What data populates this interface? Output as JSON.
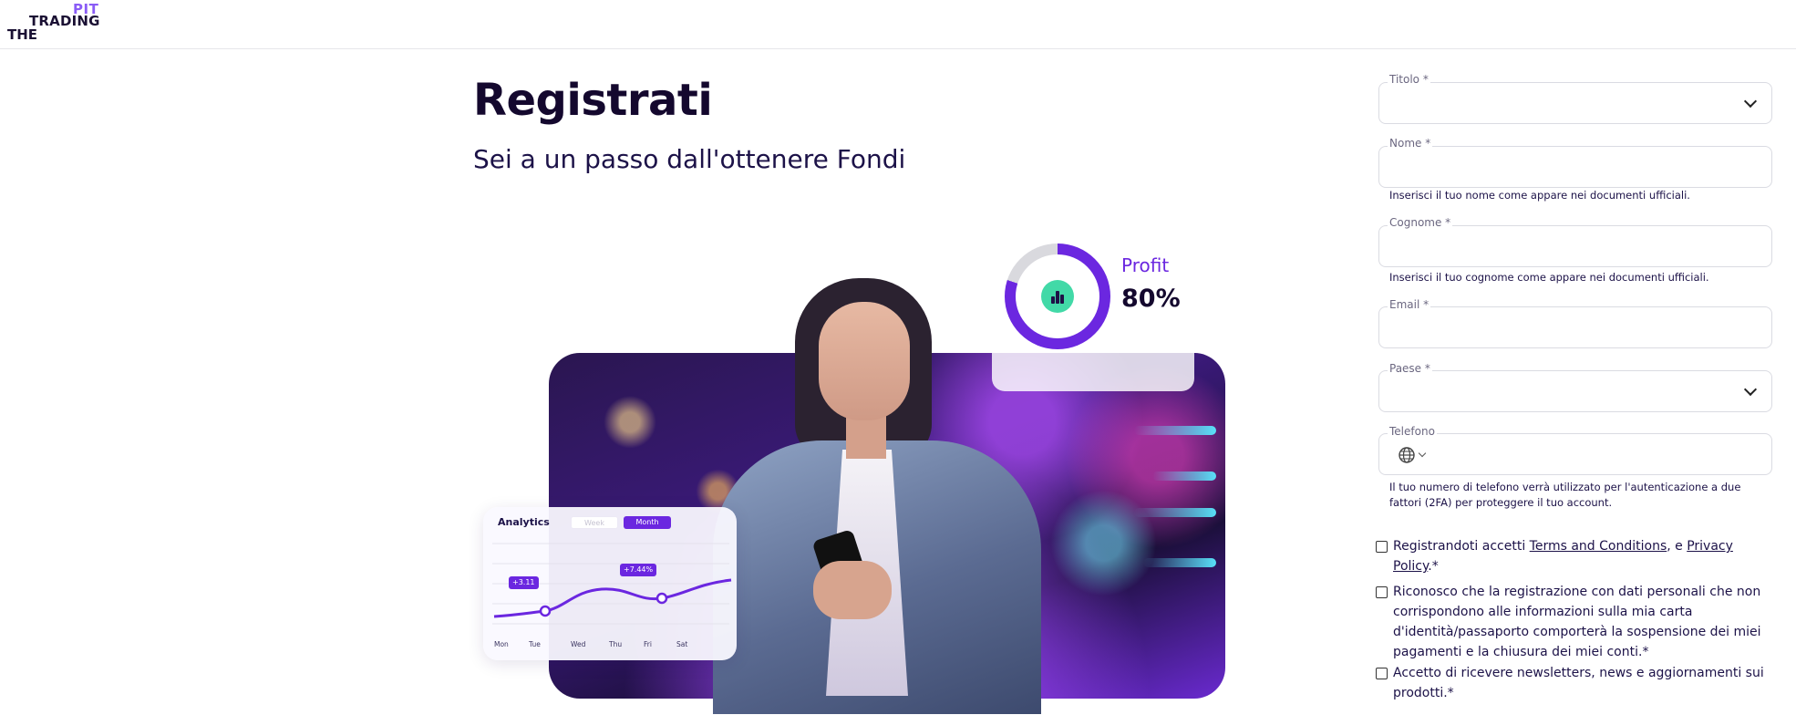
{
  "header": {
    "logo": {
      "pit": "PIT",
      "trading": "TRADING",
      "the": "THE"
    }
  },
  "hero": {
    "title": "Registrati",
    "subtitle": "Sei a un passo dall'ottenere Fondi"
  },
  "profit_widget": {
    "label": "Profit",
    "value": "80%",
    "level": 0.8
  },
  "analytics_widget": {
    "title": "Analytics",
    "tabs": [
      "Week",
      "Month"
    ],
    "selected_tab": "Month",
    "tags": [
      "+3.11",
      "+7.44%"
    ],
    "days": [
      "Mon",
      "Tue",
      "Wed",
      "Thu",
      "Fri",
      "Sat"
    ]
  },
  "form": {
    "title_field": {
      "label": "Titolo *",
      "value": ""
    },
    "first_name": {
      "label": "Nome *",
      "value": "",
      "hint": "Inserisci il tuo nome come appare nei documenti ufficiali."
    },
    "last_name": {
      "label": "Cognome *",
      "value": "",
      "hint": "Inserisci il tuo cognome come appare nei documenti ufficiali."
    },
    "email": {
      "label": "Email *",
      "value": ""
    },
    "country": {
      "label": "Paese *",
      "value": ""
    },
    "phone": {
      "label": "Telefono",
      "value": "",
      "hint_line1": "Il tuo numero di telefono verrà utilizzato per l'autenticazione a due",
      "hint_line2": "fattori (2FA) per proteggere il tuo account."
    },
    "consents": {
      "terms": {
        "before": "Registrandoti accetti ",
        "terms_link": "Terms and Conditions",
        "middle": ", e ",
        "privacy_link_1": "Privacy",
        "privacy_link_2": "Policy",
        "after": ".*"
      },
      "identity": {
        "line1": "Riconosco che la registrazione con dati personali che non",
        "line2": "corrispondono alle informazioni sulla mia carta",
        "line3": "d'identità/passaporto comporterà la sospensione dei miei",
        "line4": "pagamenti e la chiusura dei miei conti.*"
      },
      "newsletter": {
        "line1": "Accetto di ricevere newsletters, news e aggiornamenti sui",
        "line2": "prodotti.*"
      }
    }
  },
  "colors": {
    "accent": "#6b27e0",
    "logo_accent": "#8a5cf6",
    "profit_icon": "#42d9a7",
    "text_dark": "#14082e"
  },
  "icons": [
    "chevron-down-icon",
    "globe-icon",
    "bar-chart-icon"
  ]
}
